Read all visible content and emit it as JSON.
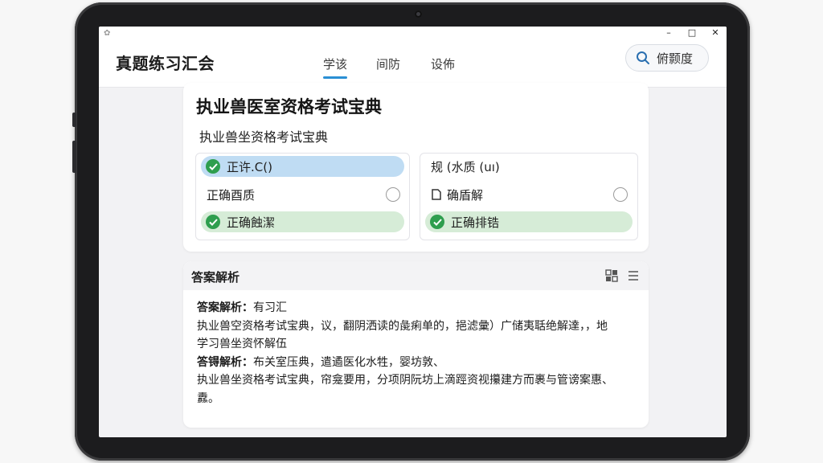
{
  "window": {
    "minimize": "–",
    "maximize": "□",
    "close": "✕"
  },
  "header": {
    "title": "真题练习汇会",
    "tabs": [
      {
        "label": "学该",
        "active": true
      },
      {
        "label": "间防",
        "active": false
      },
      {
        "label": "设佈",
        "active": false
      }
    ],
    "search_label": "俯颢度",
    "accent": "#2a8fd4"
  },
  "question": {
    "title": "执业兽医室资格考试宝典",
    "subtitle": "执业兽坐资格考试宝典",
    "left_options": [
      {
        "label": "正许.C()",
        "state": "selected"
      },
      {
        "label": "正确酉质",
        "state": "unselected"
      },
      {
        "label": "正确蝕潔",
        "state": "correct"
      }
    ],
    "right_options": [
      {
        "label": "规 (水质 (uı)",
        "state": "plain"
      },
      {
        "label": "确盾解",
        "state": "unselected"
      },
      {
        "label": "正确排锆",
        "state": "correct"
      }
    ],
    "colors": {
      "selected": "#bfdcf3",
      "correct": "#d6ecd7",
      "check": "#2e9e4e"
    }
  },
  "explanation": {
    "header": "答案解析",
    "lines": [
      {
        "label": "答案解析：",
        "text": "有习汇"
      },
      {
        "label": "",
        "text": "执业兽空资格考试宝典，议，翻阴洒读的彘痢单的，挹滤彙）广储夷聒绝解達，，地"
      },
      {
        "label": "",
        "text": "学习兽坐资怀解伍"
      },
      {
        "label": "答锝解析：",
        "text": "布关室压典，遣遹医化水牲，婴坊敦、"
      },
      {
        "label": "",
        "text": "执业兽坐资格考试宝典，帘龛要用，分项阴阮坊上滴踁资视攥建方而裹与管谤案惠、"
      },
      {
        "label": "",
        "text": "纛。"
      }
    ]
  }
}
